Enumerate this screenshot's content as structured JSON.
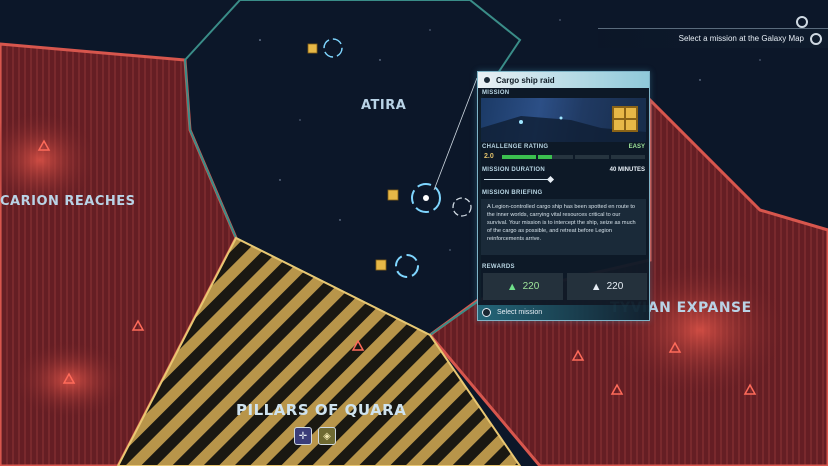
{
  "top_hint": {
    "text": "Select a mission at the Galaxy Map"
  },
  "regions": {
    "atira": "ATIRA",
    "carion": "CARION REACHES",
    "tyvian": "TYVIAN EXPANSE",
    "pillars": "PILLARS OF QUARA"
  },
  "mission_panel": {
    "title": "Cargo ship raid",
    "section_mission": "MISSION",
    "challenge_label": "CHALLENGE RATING",
    "difficulty": "EASY",
    "rating": "2.0",
    "rating_fill_fraction": 0.35,
    "duration_label": "MISSION DURATION",
    "duration": "40 MINUTES",
    "briefing_label": "MISSION BRIEFING",
    "briefing": "A Legion-controlled cargo ship has been spotted en route to the inner worlds, carrying vital resources critical to our survival. Your mission is to intercept the ship, seize as much of the cargo as possible, and retreat before Legion reinforcements arrive.",
    "rewards_label": "REWARDS",
    "reward_1": "220",
    "reward_2": "220",
    "select_label": "Select mission"
  },
  "icons": {
    "mission_cargo": "cargo-crate-icon",
    "settings": "gear-icon",
    "reward_1": "green-triangle-currency-icon",
    "reward_2": "white-triangle-currency-icon"
  },
  "colors": {
    "hostile_region": "#8a2a30",
    "neutral_region": "#c8a450",
    "panel_accent": "#8fc9d9",
    "rating_green": "#3bbf4f"
  }
}
